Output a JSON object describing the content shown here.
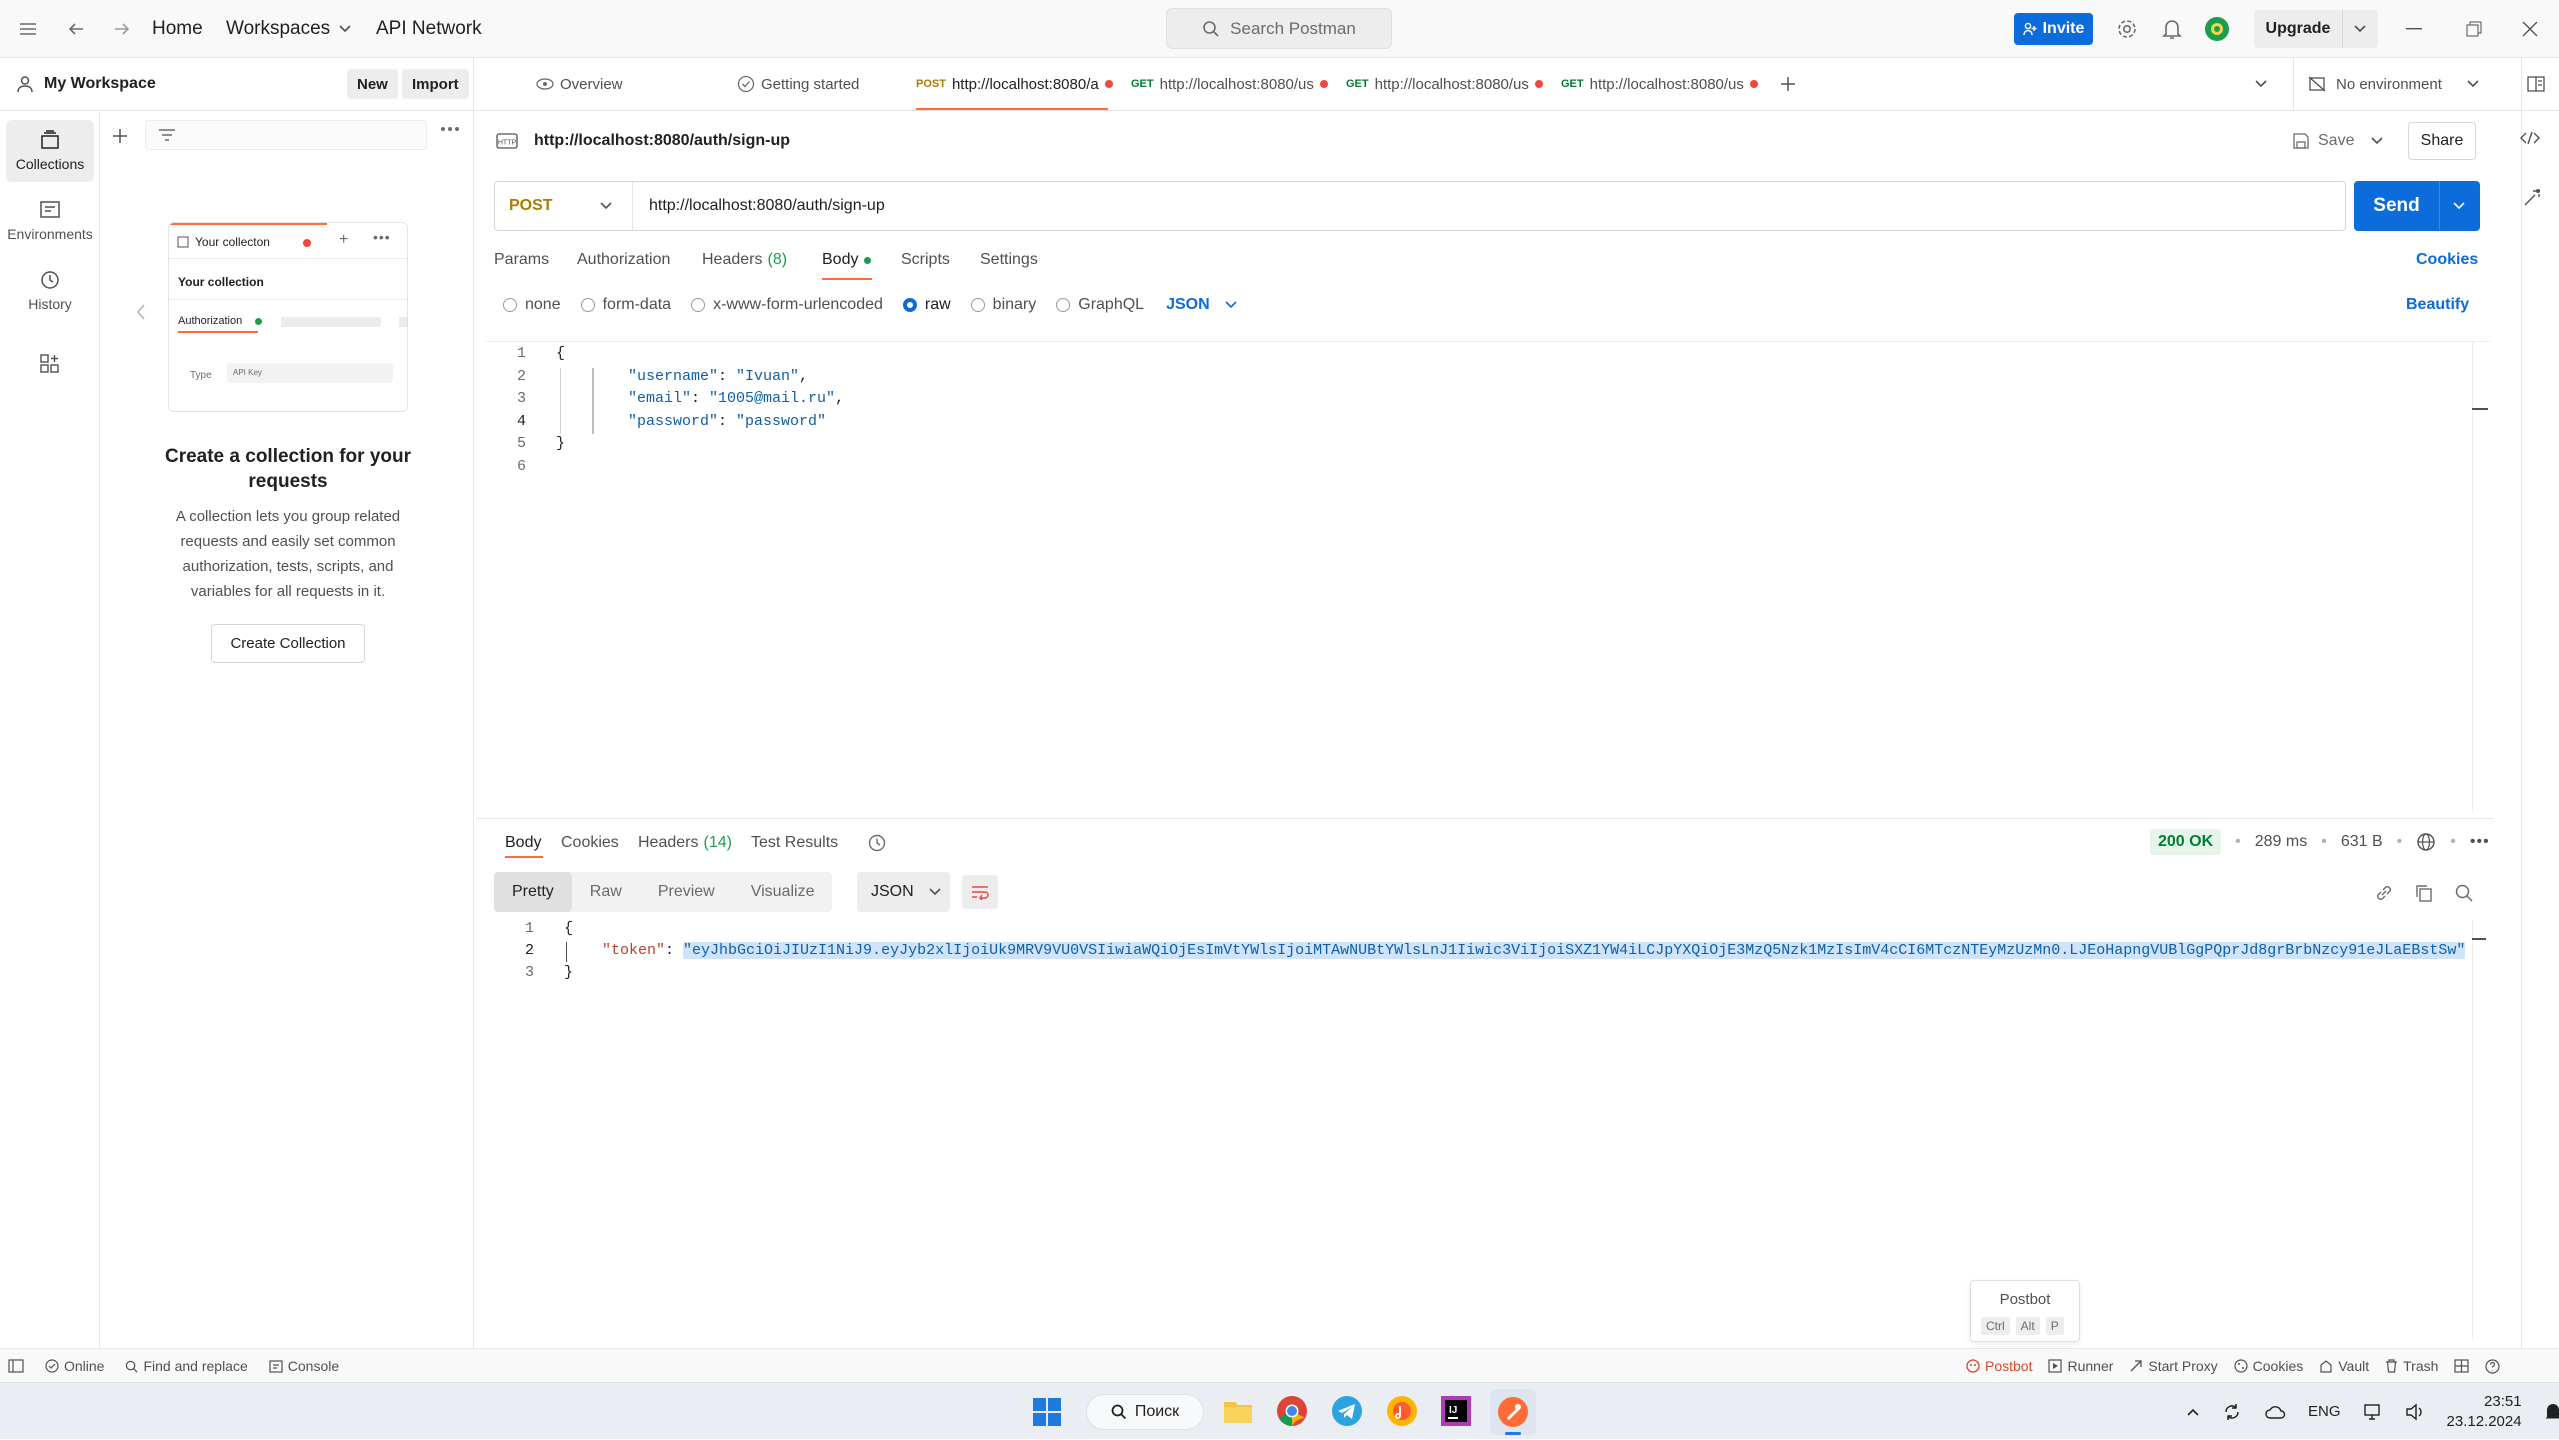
{
  "topbar": {
    "home": "Home",
    "workspaces": "Workspaces",
    "api_network": "API Network",
    "search_placeholder": "Search Postman",
    "invite": "Invite",
    "upgrade": "Upgrade"
  },
  "workspace": {
    "title": "My Workspace",
    "new_btn": "New",
    "import_btn": "Import"
  },
  "rail": {
    "items": [
      {
        "label": "Collections",
        "icon": "collections-icon"
      },
      {
        "label": "Environments",
        "icon": "environments-icon"
      },
      {
        "label": "History",
        "icon": "history-icon"
      }
    ]
  },
  "empty_state": {
    "preview_tab": "Your collecton",
    "preview_title": "Your collection",
    "preview_auth": "Authorization",
    "preview_type": "Type",
    "preview_type_value": "API Key",
    "heading": "Create a collection for your requests",
    "description": "A collection lets you group related requests and easily set common authorization, tests, scripts, and variables for all requests in it.",
    "button": "Create Collection"
  },
  "tabs": [
    {
      "label": "Overview",
      "method": ""
    },
    {
      "label": "Getting started",
      "method": ""
    },
    {
      "label": "http://localhost:8080/a",
      "method": "POST"
    },
    {
      "label": "http://localhost:8080/us",
      "method": "GET"
    },
    {
      "label": "http://localhost:8080/us",
      "method": "GET"
    },
    {
      "label": "http://localhost:8080/us",
      "method": "GET"
    }
  ],
  "environment": "No environment",
  "request": {
    "title": "http://localhost:8080/auth/sign-up",
    "save": "Save",
    "share": "Share",
    "method": "POST",
    "url": "http://localhost:8080/auth/sign-up",
    "send": "Send",
    "subtabs": {
      "params": "Params",
      "authorization": "Authorization",
      "headers": "Headers",
      "headers_count": "(8)",
      "body": "Body",
      "scripts": "Scripts",
      "settings": "Settings",
      "cookies": "Cookies"
    },
    "body_types": {
      "none": "none",
      "form_data": "form-data",
      "urlencoded": "x-www-form-urlencoded",
      "raw": "raw",
      "binary": "binary",
      "graphql": "GraphQL",
      "json": "JSON",
      "beautify": "Beautify"
    },
    "body_lines": {
      "l1": "{",
      "k2": "\"username\"",
      "v2": "\"Ivuan\"",
      "k3": "\"email\"",
      "v3": "\"1005@mail.ru\"",
      "k4": "\"password\"",
      "v4": "\"password\"",
      "l5": "}"
    }
  },
  "response": {
    "tabs": {
      "body": "Body",
      "cookies": "Cookies",
      "headers": "Headers",
      "headers_count": "(14)",
      "tests": "Test Results"
    },
    "status": "200 OK",
    "time": "289 ms",
    "size": "631 B",
    "views": {
      "pretty": "Pretty",
      "raw": "Raw",
      "preview": "Preview",
      "visualize": "Visualize",
      "format": "JSON"
    },
    "lines": {
      "l1": "{",
      "key": "\"token\"",
      "value": "\"eyJhbGciOiJIUzI1NiJ9.eyJyb2xlIjoiUk9MRV9VU0VSIiwiaWQiOjEsImVtYWlsIjoiMTAwNUBtYWlsLnJ1Iiwic3ViIjoiSXZ1YW4iLCJpYXQiOjE3MzQ5Nzk1MzIsImV4cCI6MTczNTEyMzUzMn0.LJEoHapngVUBlGgPQprJd8grBrbNzcy91eJLaEBstSw\"",
      "l3": "}"
    }
  },
  "postbot_popup": {
    "title": "Postbot",
    "k1": "Ctrl",
    "k2": "Alt",
    "k3": "P"
  },
  "statusbar": {
    "online": "Online",
    "find_replace": "Find and replace",
    "console": "Console",
    "postbot": "Postbot",
    "runner": "Runner",
    "start_proxy": "Start Proxy",
    "cookies": "Cookies",
    "vault": "Vault",
    "trash": "Trash"
  },
  "taskbar": {
    "search": "Поиск",
    "lang": "ENG",
    "time": "23:51",
    "date": "23.12.2024"
  },
  "colors": {
    "accent": "#0c6cdb",
    "post": "#ad7a03",
    "get": "#007f31",
    "unsaved_dot": "#f0473c",
    "postman_orange": "#ff6c37"
  }
}
